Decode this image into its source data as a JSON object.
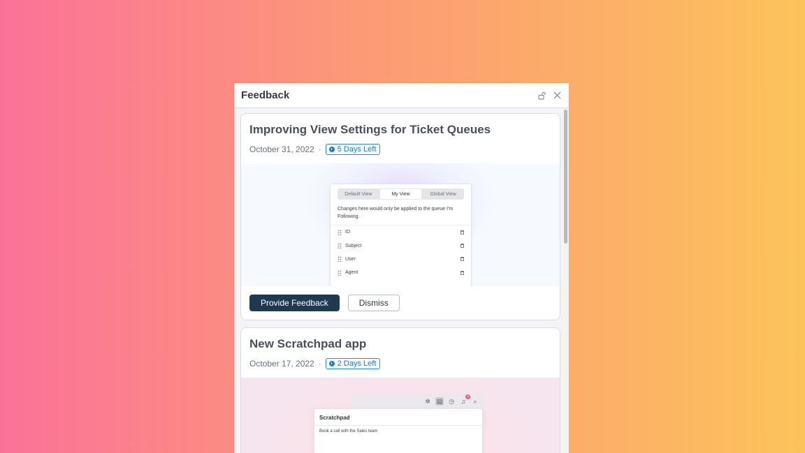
{
  "panel": {
    "title": "Feedback",
    "icons": [
      "unlock-icon",
      "close-icon"
    ]
  },
  "cards": [
    {
      "title": "Improving View Settings for Ticket Queues",
      "date": "October 31, 2022",
      "separator": "·",
      "badge": "5 Days Left",
      "preview": {
        "tabs": [
          "Default View",
          "My View",
          "Global View"
        ],
        "active_tab": "My View",
        "notice": "Changes here would only be applied to the queue I'm Following.",
        "rows": [
          "ID",
          "Subject",
          "User",
          "Agent"
        ]
      },
      "primary_button": "Provide Feedback",
      "secondary_button": "Dismiss"
    },
    {
      "title": "New Scratchpad app",
      "date": "October 17, 2022",
      "separator": "·",
      "badge": "2 Days Left",
      "preview": {
        "toolbar_icons": [
          "sparkle-icon",
          "note-icon",
          "clock-icon",
          "bell-icon",
          "search-icon"
        ],
        "notification_count": "2",
        "scratchpad_title": "Scratchpad",
        "scratchpad_text": "Book a call with the Sales team"
      }
    }
  ],
  "colors": {
    "primary_button": "#1e3a53",
    "badge_blue": "#1f7fd0",
    "background_start": "#fb7299",
    "background_end": "#fcc35a"
  }
}
